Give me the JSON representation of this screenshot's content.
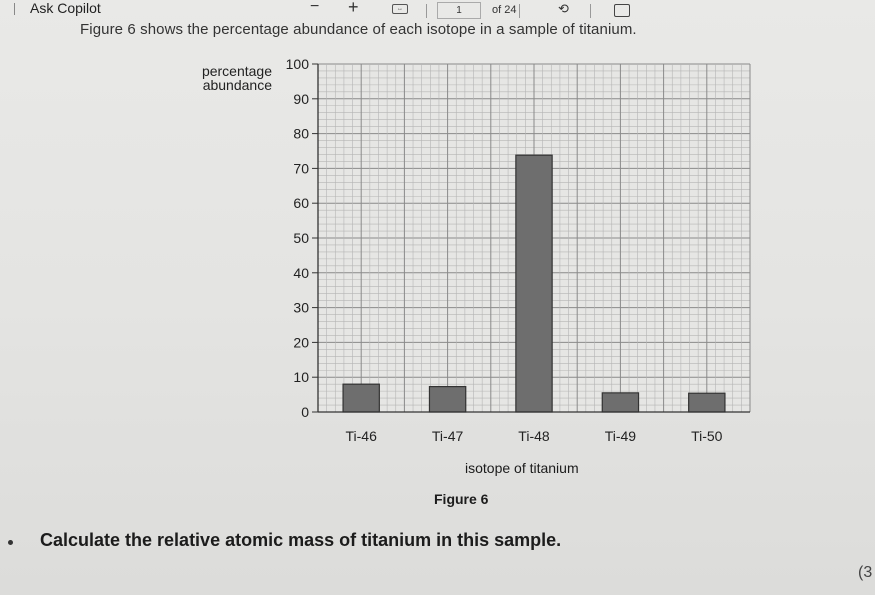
{
  "toolbar": {
    "copilot_label": "Ask Copilot",
    "zoom_out": "−",
    "zoom_in": "+",
    "page_number": "1",
    "page_total": "of 24"
  },
  "document": {
    "intro": "Figure 6 shows the percentage abundance of each isotope in a sample of titanium.",
    "figure_caption": "Figure 6",
    "question": "Calculate the relative atomic mass of titanium in this sample.",
    "marks_fragment": "(3"
  },
  "chart_data": {
    "type": "bar",
    "categories": [
      "Ti-46",
      "Ti-47",
      "Ti-48",
      "Ti-49",
      "Ti-50"
    ],
    "values": [
      8.0,
      7.3,
      73.8,
      5.5,
      5.4
    ],
    "ylabel": "percentage abundance",
    "xlabel": "isotope of titanium",
    "ylim": [
      0,
      100
    ],
    "yticks": [
      0,
      10,
      20,
      30,
      40,
      50,
      60,
      70,
      80,
      90,
      100
    ],
    "yticks_labels": [
      "0",
      "10",
      "20",
      "30",
      "40",
      "50",
      "60",
      "70",
      "80",
      "90",
      "100"
    ],
    "grid": true,
    "bar_color": "#6e6e6e"
  }
}
